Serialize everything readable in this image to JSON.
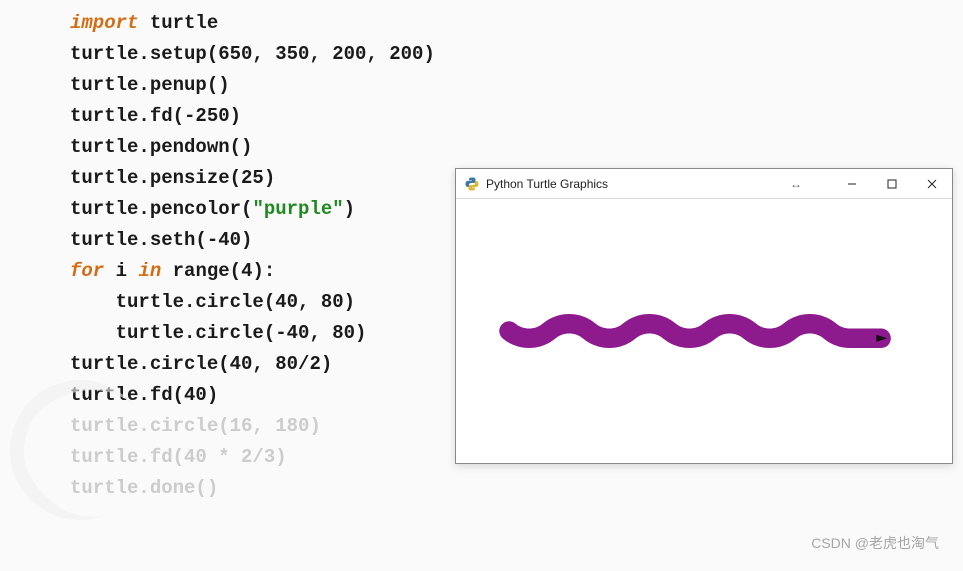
{
  "code": {
    "lines": [
      {
        "parts": [
          {
            "cls": "kw",
            "t": "import"
          },
          {
            "cls": "",
            "t": " turtle"
          }
        ]
      },
      {
        "parts": [
          {
            "cls": "",
            "t": "turtle.setup(650, 350, 200, 200)"
          }
        ]
      },
      {
        "parts": [
          {
            "cls": "",
            "t": "turtle.penup()"
          }
        ]
      },
      {
        "parts": [
          {
            "cls": "",
            "t": "turtle.fd(-250)"
          }
        ]
      },
      {
        "parts": [
          {
            "cls": "",
            "t": "turtle.pendown()"
          }
        ]
      },
      {
        "parts": [
          {
            "cls": "",
            "t": "turtle.pensize(25)"
          }
        ]
      },
      {
        "parts": [
          {
            "cls": "",
            "t": "turtle.pencolor("
          },
          {
            "cls": "str",
            "t": "\"purple\""
          },
          {
            "cls": "",
            "t": ")"
          }
        ]
      },
      {
        "parts": [
          {
            "cls": "",
            "t": "turtle.seth(-40)"
          }
        ]
      },
      {
        "parts": [
          {
            "cls": "kw",
            "t": "for"
          },
          {
            "cls": "",
            "t": " i "
          },
          {
            "cls": "kw",
            "t": "in"
          },
          {
            "cls": "",
            "t": " range(4):"
          }
        ]
      },
      {
        "parts": [
          {
            "cls": "",
            "t": "    turtle.circle(40, 80)"
          }
        ]
      },
      {
        "parts": [
          {
            "cls": "",
            "t": "    turtle.circle(-40, 80)"
          }
        ]
      },
      {
        "parts": [
          {
            "cls": "",
            "t": "turtle.circle(40, 80/2)"
          }
        ]
      },
      {
        "parts": [
          {
            "cls": "",
            "t": "turtle.fd(40)"
          }
        ]
      },
      {
        "parts": [
          {
            "cls": "faded",
            "t": "turtle.circle(16, 180)"
          }
        ]
      },
      {
        "parts": [
          {
            "cls": "faded",
            "t": "turtle.fd(40 * 2/3)"
          }
        ]
      },
      {
        "parts": [
          {
            "cls": "faded",
            "t": "turtle.done()"
          }
        ]
      }
    ]
  },
  "window": {
    "title": "Python Turtle Graphics",
    "hint_glyph": "↔",
    "min_label": "minimize",
    "max_label": "maximize",
    "close_label": "close"
  },
  "snake": {
    "color": "#8e1b8e",
    "pensize": 25
  },
  "watermark": "CSDN @老虎也淘气"
}
